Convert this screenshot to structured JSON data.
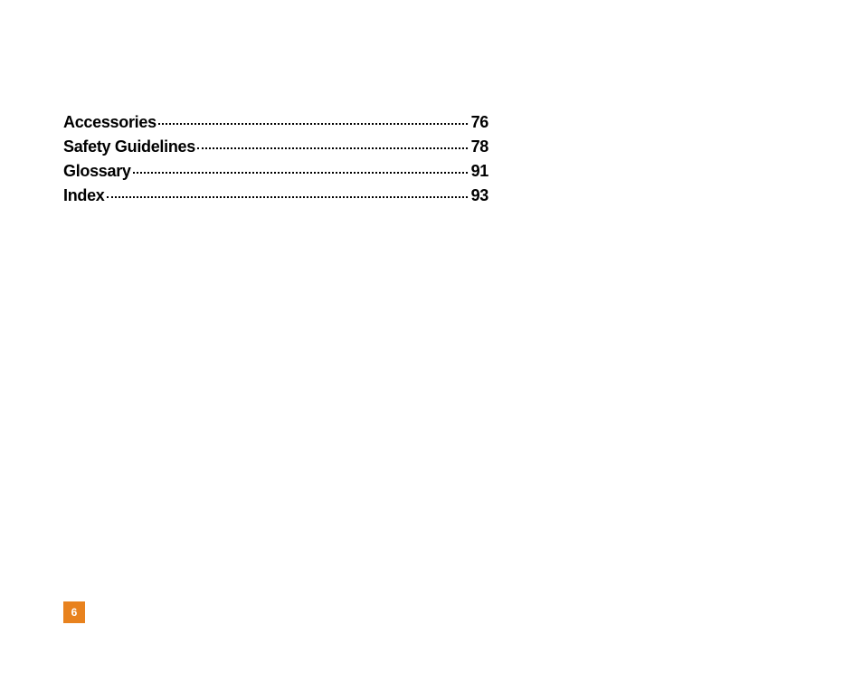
{
  "toc": {
    "entries": [
      {
        "title": "Accessories",
        "page": "76"
      },
      {
        "title": "Safety Guidelines",
        "page": "78"
      },
      {
        "title": "Glossary",
        "page": "91"
      },
      {
        "title": "Index",
        "page": "93"
      }
    ]
  },
  "page_number": "6",
  "colors": {
    "accent": "#e8821e"
  }
}
